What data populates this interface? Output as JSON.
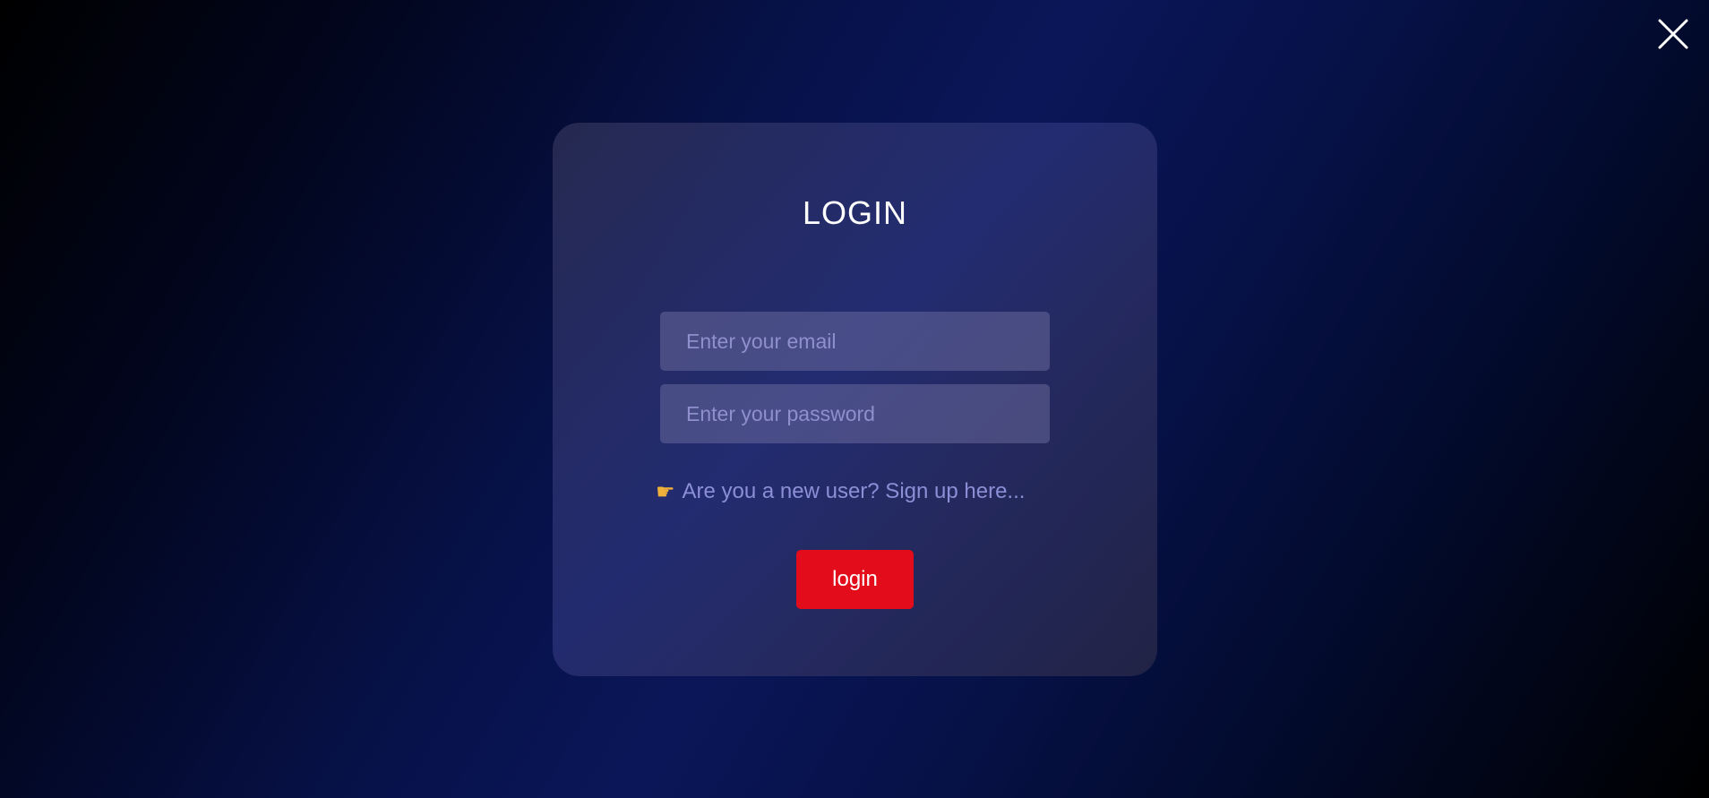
{
  "page": {
    "close_icon": "close-icon"
  },
  "login_form": {
    "title": "LOGIN",
    "email_placeholder": "Enter your email",
    "password_placeholder": "Enter your password",
    "signup_icon": "pointing-hand-icon",
    "signup_text": "Are you a new user? Sign up here...",
    "login_label": "login"
  },
  "colors": {
    "accent_button": "#e30c1a",
    "link_text": "#8c8ed6",
    "background_dark": "#000000",
    "background_blue": "#0a1658"
  }
}
